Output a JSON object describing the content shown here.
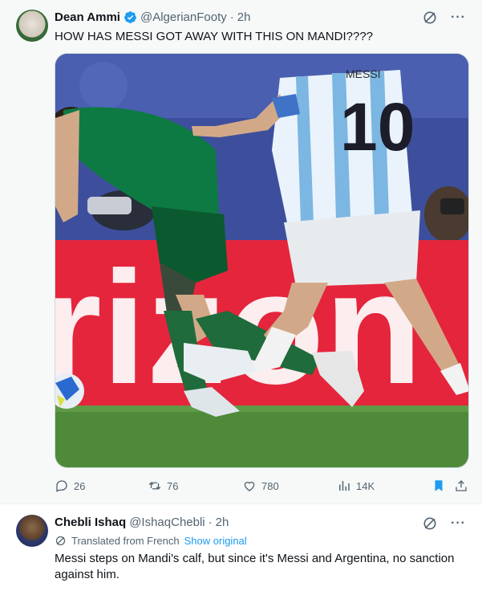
{
  "posts": [
    {
      "author_name": "Dean Ammi",
      "handle": "@AlgerianFooty",
      "separator": "·",
      "time": "2h",
      "text": "HOW HAS MESSI GOT AWAY WITH THIS ON MANDI????",
      "media": {
        "banner_text": "rizon",
        "jersey_name": "MESSI",
        "jersey_number": "10"
      },
      "stats": {
        "replies": "26",
        "reposts": "76",
        "likes": "780",
        "views": "14K"
      },
      "bookmark_color": "#1d9bf0"
    },
    {
      "author_name": "Chebli Ishaq",
      "handle": "@IshaqChebli",
      "separator": "·",
      "time": "2h",
      "translated_label": "Translated from French",
      "show_original": "Show original",
      "text": "Messi steps on Mandi's calf, but since it's Messi and Argentina, no sanction against him."
    }
  ],
  "more_label": "···",
  "icons": [
    "verified-badge-icon",
    "grok-icon",
    "more-icon",
    "reply-icon",
    "repost-icon",
    "like-icon",
    "views-icon",
    "bookmark-icon",
    "share-icon",
    "translate-icon"
  ],
  "accent_color": "#1d9bf0"
}
